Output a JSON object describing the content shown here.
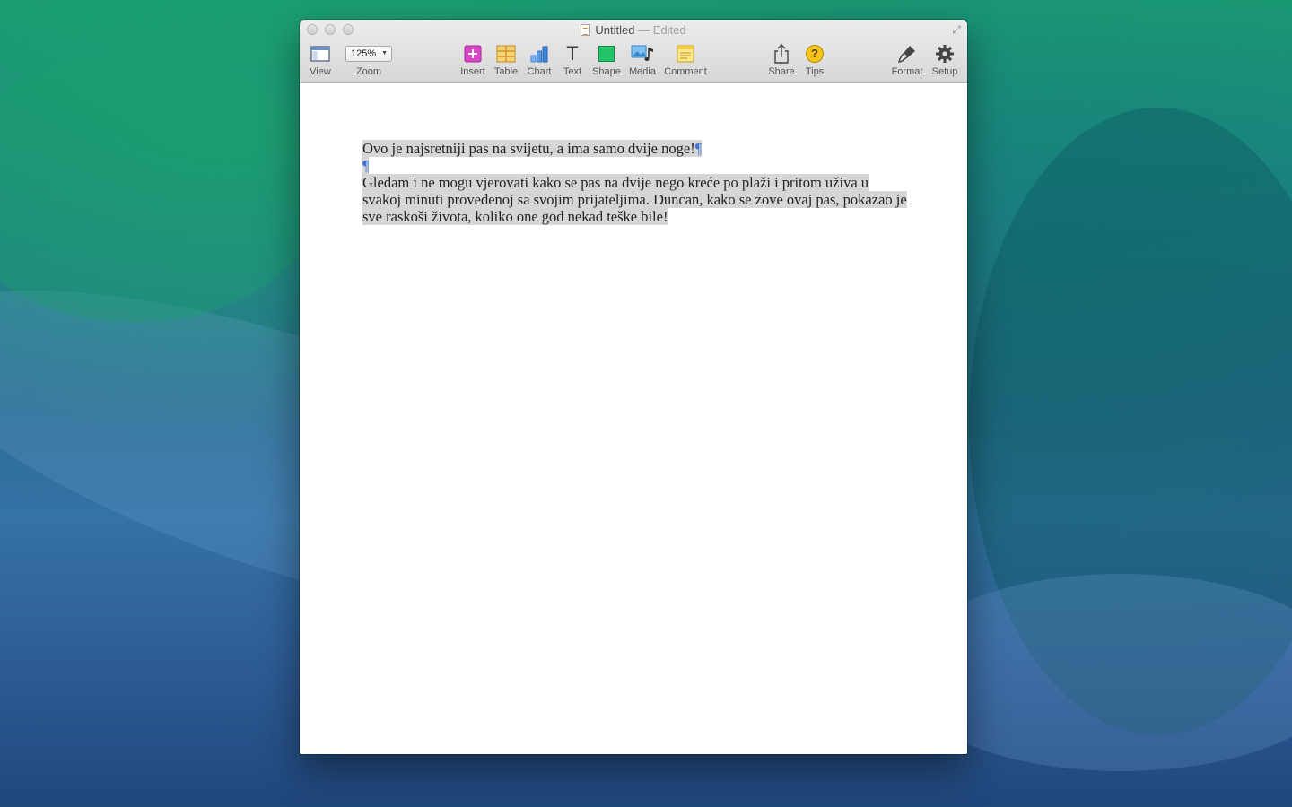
{
  "window": {
    "title": "Untitled",
    "title_separator": "—",
    "title_status": "Edited"
  },
  "toolbar": {
    "view_label": "View",
    "zoom_value": "125%",
    "zoom_label": "Zoom",
    "insert_label": "Insert",
    "table_label": "Table",
    "chart_label": "Chart",
    "text_label": "Text",
    "shape_label": "Shape",
    "media_label": "Media",
    "comment_label": "Comment",
    "share_label": "Share",
    "tips_label": "Tips",
    "tips_glyph": "?",
    "format_label": "Format",
    "setup_label": "Setup",
    "text_glyph": "T"
  },
  "document": {
    "paragraph1": "Ovo je najsretniji pas na svijetu, a ima samo dvije noge!",
    "pilcrow": "¶",
    "paragraph2": "Gledam i ne mogu vjerovati kako se pas na dvije nego kreće po plaži i pritom uživa u svakoj minuti provedenoj sa svojim prijateljima. Duncan, kako se zove ovaj pas, pokazao je sve raskoši života, koliko one god nekad teške bile!"
  },
  "colors": {
    "insert_icon": "#d946c8",
    "table_icon": "#f2b63a",
    "chart_icon": "#3f83d8",
    "shape_icon": "#22c36b",
    "media_icon": "#5aa8e8",
    "comment_icon": "#f4d35e",
    "tips_icon": "#f3c21b",
    "selection": "#d6d6d6",
    "pilcrow": "#3f73d6"
  }
}
